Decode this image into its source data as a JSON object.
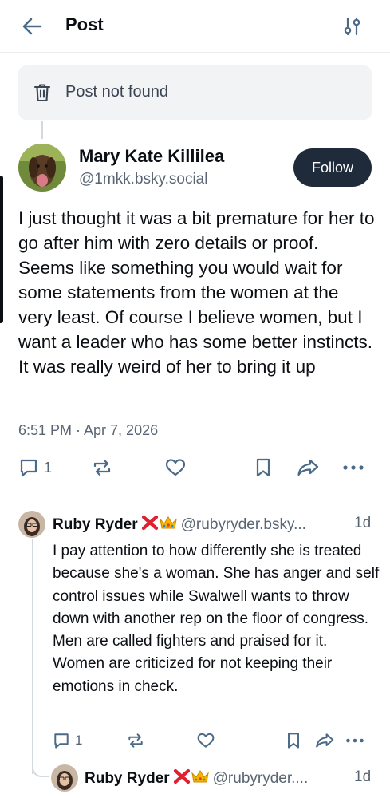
{
  "header": {
    "title": "Post",
    "back_icon": "arrow-left-icon",
    "filter_icon": "sliders-icon"
  },
  "notice": {
    "text": "Post not found",
    "icon": "trash-icon"
  },
  "post": {
    "author": {
      "name": "Mary Kate Killilea",
      "handle": "@1mkk.bsky.social"
    },
    "follow_label": "Follow",
    "text": "I just thought it was a bit premature for her to go after him with zero details or proof. Seems like something you would wait for some statements from the women at the very least. Of course I believe women, but I want a leader who has some better instincts. It was really weird of her to bring it up",
    "timestamp": "6:51 PM · Apr 7, 2026",
    "reply_count": "1"
  },
  "replies": [
    {
      "author": "Ruby Ryder",
      "handle": "@rubyryder.bsky...",
      "time": "1d",
      "badges": [
        "cross-mark-emoji",
        "crown-emoji"
      ],
      "text": "I pay attention to how differently she is treated because she's a woman. She has anger and self control issues while Swalwell wants to throw down with another rep on the floor of congress. Men are called fighters and praised for it. Women are criticized for not keeping their emotions in check.",
      "reply_count": "1"
    },
    {
      "author": "Ruby Ryder",
      "handle": "@rubyryder....",
      "time": "1d",
      "badges": [
        "cross-mark-emoji",
        "crown-emoji"
      ]
    }
  ],
  "colors": {
    "follow_bg": "#1f2a3a",
    "secondary_text": "#5a6573",
    "notice_bg": "#f1f3f5",
    "icon": "#4b6a88"
  }
}
